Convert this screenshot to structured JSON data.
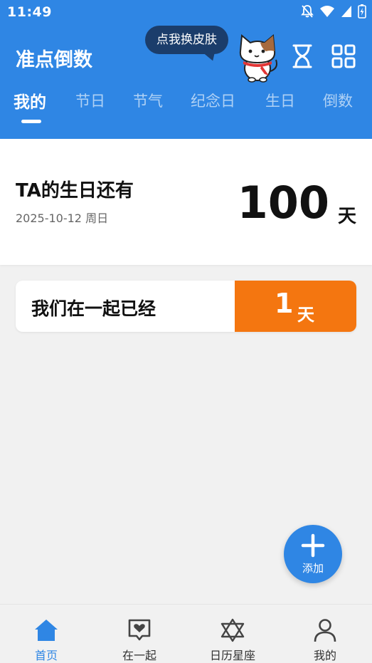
{
  "status_bar": {
    "time": "11:49"
  },
  "header": {
    "title": "准点倒数",
    "skin_bubble": "点我换皮肤",
    "icons": [
      "hourglass-icon",
      "grid-icon"
    ],
    "colors": {
      "primary": "#2f86e4",
      "bubble": "#1b3d6b"
    }
  },
  "tabs": [
    {
      "label": "我的",
      "active": true
    },
    {
      "label": "节日",
      "active": false
    },
    {
      "label": "节气",
      "active": false
    },
    {
      "label": "纪念日",
      "active": false
    },
    {
      "label": "生日",
      "active": false
    },
    {
      "label": "倒数",
      "active": false
    }
  ],
  "main_card": {
    "title": "TA的生日还有",
    "date": "2025-10-12 周日",
    "days": "100",
    "unit": "天"
  },
  "together_card": {
    "label": "我们在一起已经",
    "days": "1",
    "unit": "天",
    "accent": "#f47610"
  },
  "fab": {
    "label": "添加",
    "icon": "plus-icon"
  },
  "bottom_nav": [
    {
      "label": "首页",
      "icon": "home-icon",
      "active": true
    },
    {
      "label": "在一起",
      "icon": "heart-chat-icon",
      "active": false
    },
    {
      "label": "日历星座",
      "icon": "star-of-david-icon",
      "active": false
    },
    {
      "label": "我的",
      "icon": "person-icon",
      "active": false
    }
  ]
}
